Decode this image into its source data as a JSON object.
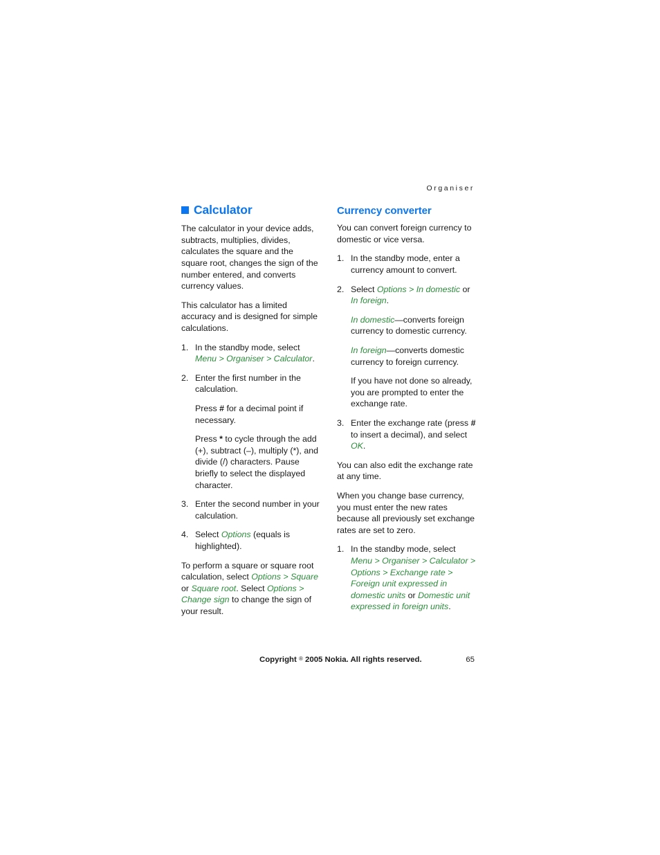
{
  "header": {
    "running_head": "Organiser"
  },
  "left_column": {
    "heading": "Calculator",
    "intro": "The calculator in your device adds, subtracts, multiplies, divides, calculates the square and the square root, changes the sign of the number entered, and converts currency values.",
    "accuracy_note": "This calculator has a limited accuracy and is designed for simple calculations.",
    "steps": [
      {
        "num": "1.",
        "text_1": "In the standby mode, select ",
        "menu_1": "Menu",
        "sep_1": " > ",
        "menu_2": "Organiser",
        "sep_2": " > ",
        "menu_3": "Calculator",
        "tail": "."
      },
      {
        "num": "2.",
        "text": "Enter the first number in the calculation.",
        "sub_1_pre": "Press ",
        "sub_1_key": "#",
        "sub_1_post": " for a decimal point if necessary.",
        "sub_2_pre": "Press ",
        "sub_2_key": "*",
        "sub_2_post": " to cycle through the add (+), subtract (–), multiply (*), and divide (/) characters. Pause briefly to select the displayed character."
      },
      {
        "num": "3.",
        "text": "Enter the second number in your calculation."
      },
      {
        "num": "4.",
        "text_1": "Select ",
        "menu_1": "Options",
        "tail": " (equals is highlighted)."
      }
    ],
    "square_para": {
      "t1": "To perform a square or square root calculation, select ",
      "m1": "Options",
      "t2": " > ",
      "m2": "Square",
      "t3": " or ",
      "m3": "Square root",
      "t4": ". Select ",
      "m4": "Options",
      "t5": " > ",
      "m5": "Change sign",
      "t6": " to change the sign of your result."
    }
  },
  "right_column": {
    "heading": "Currency converter",
    "intro": "You can convert foreign currency to domestic or vice versa.",
    "steps": [
      {
        "num": "1.",
        "text": "In the standby mode, enter a currency amount to convert."
      },
      {
        "num": "2.",
        "t1": "Select ",
        "m1": "Options",
        "t2": " > ",
        "m2": "In domestic",
        "t3": " or ",
        "m3": "In foreign",
        "t4": ".",
        "sub_1_menu": "In domestic",
        "sub_1_text": "—converts foreign currency to domestic currency.",
        "sub_2_menu": "In foreign",
        "sub_2_text": "—converts domestic currency to foreign currency.",
        "sub_3_text": "If you have not done so already, you are prompted to enter the exchange rate."
      },
      {
        "num": "3.",
        "t1": "Enter the exchange rate (press ",
        "k1": "#",
        "t2": " to insert a decimal), and select ",
        "m1": "OK",
        "t3": "."
      }
    ],
    "edit_note": "You can also edit the exchange rate at any time.",
    "base_currency_note": "When you change base currency, you must enter the new rates because all previously set exchange rates are set to zero.",
    "final_step": {
      "num": "1.",
      "t1": "In the standby mode, select ",
      "m1": "Menu",
      "t2": " > ",
      "m2": "Organiser ",
      "t3": " > ",
      "m3": "Calculator",
      "t4": " > ",
      "m4": "Options",
      "t5": " > ",
      "m5": "Exchange rate",
      "t6": " > ",
      "m6": "Foreign unit expressed in domestic units",
      "t7": " or ",
      "m7": "Domestic unit expressed in foreign units",
      "t8": "."
    }
  },
  "footer": {
    "copyright_pre": "Copyright ",
    "copyright_reg": "®",
    "copyright_post": " 2005 Nokia. All rights reserved.",
    "page_number": "65"
  },
  "colors": {
    "heading_blue": "#0b76ef",
    "menu_green": "#2d8c3c",
    "body_text": "#1a1a1a",
    "page_background": "#ffffff"
  }
}
